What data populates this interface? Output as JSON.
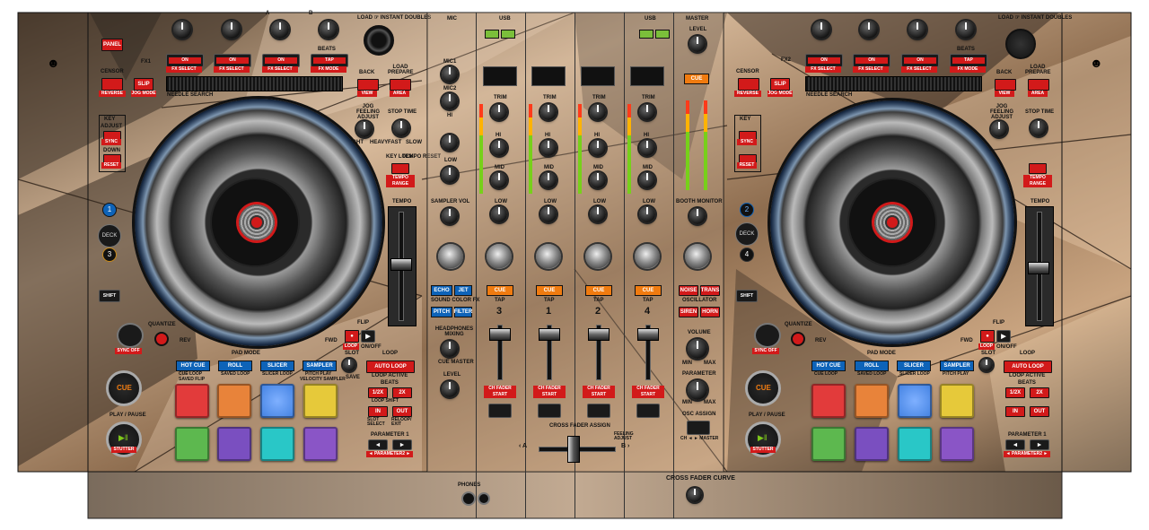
{
  "colors": {
    "accent_red": "#d21a1a",
    "accent_blue": "#0e63b8",
    "cue_orange": "#f07b10",
    "pad_red": "#e23b3b",
    "pad_orange": "#e8833a",
    "pad_blue": "#3f7fe0",
    "pad_yellow": "#e6c93a",
    "pad_green": "#5db84f",
    "pad_purple": "#7a4fc0",
    "pad_teal": "#29c7c7",
    "pad_violet": "#8a55c6"
  },
  "left_deck": {
    "top_row": {
      "panel": "PANEL",
      "fx1": "FX1",
      "on": "ON",
      "fx_select": "FX SELECT",
      "tap": "TAP",
      "fx_mode": "FX MODE",
      "beats": "BEATS",
      "load_instant_doubles": "LOAD ☞ INSTANT DOUBLES",
      "a": "A",
      "b": "B"
    },
    "censor": "CENSOR",
    "reverse": "REVERSE",
    "slip": "SLIP",
    "jog_mode": "JOG MODE",
    "needle_search": "NEEDLE SEARCH",
    "back": "BACK",
    "view": "VIEW",
    "load_prepare": "LOAD PREPARE",
    "area": "AREA",
    "key": "KEY",
    "adjust": "ADJUST",
    "sync": "SYNC",
    "down": "DOWN",
    "reset": "RESET",
    "jog_feeling": "JOG FEELING ADJUST",
    "light": "LIGHT",
    "heavy": "HEAVY",
    "stop_time": "STOP TIME",
    "fast": "FAST",
    "slow": "SLOW",
    "key_lock": "KEY LOCK",
    "tempo_reset": "TEMPO RESET",
    "tempo_range": "TEMPO RANGE",
    "tempo": "TEMPO",
    "deck_labels": [
      "1",
      "DECK",
      "3"
    ],
    "shift": "SHIFT",
    "quantize": "QUANTIZE",
    "rev": "REV",
    "fwd": "FWD",
    "flip": "FLIP",
    "rec": "REC",
    "loop": "LOOP",
    "on_off": "ON/OFF",
    "slot": "SLOT",
    "save": "SAVE",
    "sync_off": "SYNC OFF",
    "pad_mode": "PAD MODE",
    "modes": [
      "HOT CUE",
      "ROLL",
      "SLICER",
      "SAMPLER"
    ],
    "mode_subs": [
      "CUE LOOP",
      "SAVED LOOP",
      "SLICER LOOP",
      "PITCH PLAY"
    ],
    "mode_subs2": [
      "SAVED FLIP",
      "",
      "",
      "VELOCITY SAMPLER"
    ],
    "loop_title": "LOOP",
    "auto_loop": "AUTO LOOP",
    "loop_active": "LOOP ACTIVE",
    "beats": "BEATS",
    "half": "1/2X",
    "double": "2X",
    "loop_shift": "LOOP SHIFT",
    "in": "IN",
    "out": "OUT",
    "slot_select": "SLOT SELECT",
    "reloop_exit": "RELOOP/ EXIT",
    "cue": "CUE",
    "play_pause": "PLAY / PAUSE",
    "stutter": "STUTTER",
    "parameter1": "PARAMETER 1",
    "parameter2": "◄ PARAMETER2 ►"
  },
  "right_deck": {
    "deck_labels": [
      "2",
      "DECK",
      "4"
    ],
    "fx2": "FX2"
  },
  "mixer": {
    "mic": "MIC",
    "usb": "USB",
    "master": "MASTER",
    "level": "LEVEL",
    "mic1": "MIC1",
    "mic2": "MIC2",
    "hi": "HI",
    "low": "LOW",
    "sampler_vol": "SAMPLER VOL",
    "trim": "TRIM",
    "mid": "MID",
    "cfx": "CFX",
    "cue": "CUE",
    "tap": "TAP",
    "booth_monitor": "BOOTH MONITOR",
    "channel_numbers": [
      "3",
      "1",
      "2",
      "4"
    ],
    "channel_letters": [
      "A",
      "B",
      "C",
      "D"
    ],
    "echo": "ECHO",
    "jet": "JET",
    "pitch": "PITCH",
    "filter": "FILTER",
    "sound_color_fx": "SOUND COLOR FX",
    "headphones_mixing": "HEADPHONES MIXING",
    "cue_master": "CUE MASTER",
    "level_phones": "LEVEL",
    "ch_fader_start": "CH FADER START",
    "a_thru_b": "A THRU B",
    "oscillator": "OSCILLATOR",
    "noise": "NOISE",
    "siren": "SIREN",
    "horn": "HORN",
    "trans": "TRANS",
    "volume": "VOLUME",
    "min": "MIN",
    "max": "MAX",
    "parameter": "PARAMETER",
    "osc_assign": "OSC ASSIGN",
    "ch_master": "CH ◄ ► MASTER",
    "cross_fader_assign": "CROSS FADER ASSIGN",
    "cross_a": "‹ A",
    "cross_b": "B ›",
    "feeling_adjust": "FEELING ADJUST"
  },
  "bottom": {
    "phones": "PHONES",
    "cross_fader_curve": "CROSS FADER CURVE"
  }
}
